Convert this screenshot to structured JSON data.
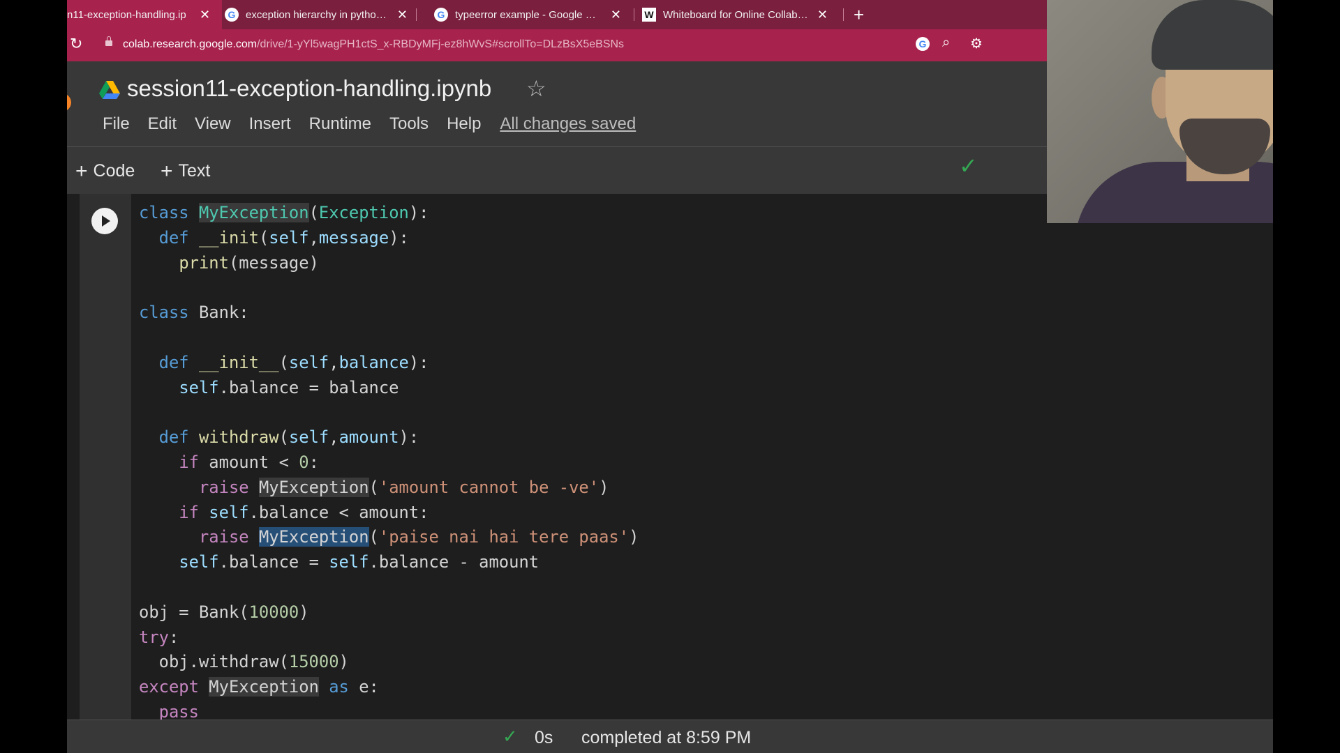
{
  "browser": {
    "tabs": [
      {
        "title": "n11-exception-handling.ip",
        "icon": "colab-icon",
        "active": true
      },
      {
        "title": "exception hierarchy in python - C",
        "icon": "google-icon",
        "active": false
      },
      {
        "title": "typeerror example - Google Sear",
        "icon": "google-icon",
        "active": false
      },
      {
        "title": "Whiteboard for Online Collabora",
        "icon": "whiteboard-icon",
        "active": false
      }
    ],
    "url_host": "colab.research.google.com",
    "url_path": "/drive/1-yYl5wagPH1ctS_x-RBDyMFj-ez8hWvS#scrollTo=DLzBsX5eBSNs",
    "accent_color": "#a8224e"
  },
  "notebook": {
    "title": "session11-exception-handling.ipynb",
    "menu": [
      "File",
      "Edit",
      "View",
      "Insert",
      "Runtime",
      "Tools",
      "Help"
    ],
    "save_status": "All changes saved"
  },
  "toolbar": {
    "code_label": "Code",
    "text_label": "Text"
  },
  "cell": {
    "lines": [
      "class MyException(Exception):",
      "  def __init(self,message):",
      "    print(message)",
      "",
      "class Bank:",
      "",
      "  def __init__(self,balance):",
      "    self.balance = balance",
      "",
      "  def withdraw(self,amount):",
      "    if amount < 0:",
      "      raise MyException('amount cannot be -ve')",
      "    if self.balance < amount:",
      "      raise MyException('paise nai hai tere paas')",
      "    self.balance = self.balance - amount",
      "",
      "obj = Bank(10000)",
      "try:",
      "  obj.withdraw(15000)",
      "except MyException as e:",
      "  pass"
    ]
  },
  "status": {
    "duration": "0s",
    "message": "completed at 8:59 PM"
  }
}
